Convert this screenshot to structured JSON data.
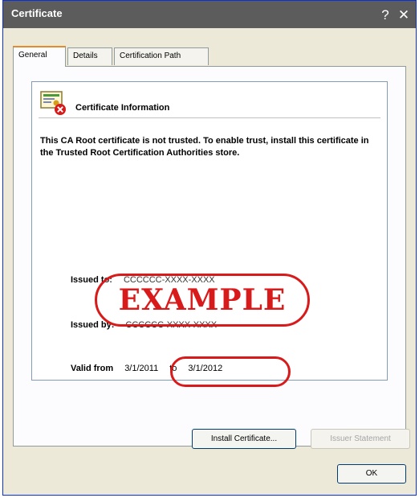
{
  "window": {
    "title": "Certificate",
    "help_glyph": "?",
    "close_glyph": "✕"
  },
  "tabs": [
    {
      "label": "General",
      "active": true
    },
    {
      "label": "Details",
      "active": false
    },
    {
      "label": "Certification Path",
      "active": false
    }
  ],
  "info": {
    "icon": "certificate-untrusted-icon",
    "heading": "Certificate Information",
    "warning": "This CA Root certificate is not trusted. To enable trust, install this certificate in the Trusted Root Certification Authorities store.",
    "issued_to_label": "Issued to:",
    "issued_to_value": "CCCCCC-XXXX-XXXX",
    "issued_by_label": "Issued by:",
    "issued_by_value": "CCCCCC-XXXX-XXXX",
    "valid_from_label": "Valid from",
    "valid_from_value": "3/1/2011",
    "valid_to_label": "to",
    "valid_to_value": "3/1/2012"
  },
  "watermark": "EXAMPLE",
  "buttons": {
    "install": "Install Certificate...",
    "issuer": "Issuer Statement",
    "ok": "OK"
  },
  "colors": {
    "annotation_red": "#d91a1a",
    "titlebar": "#5c5c5c"
  }
}
